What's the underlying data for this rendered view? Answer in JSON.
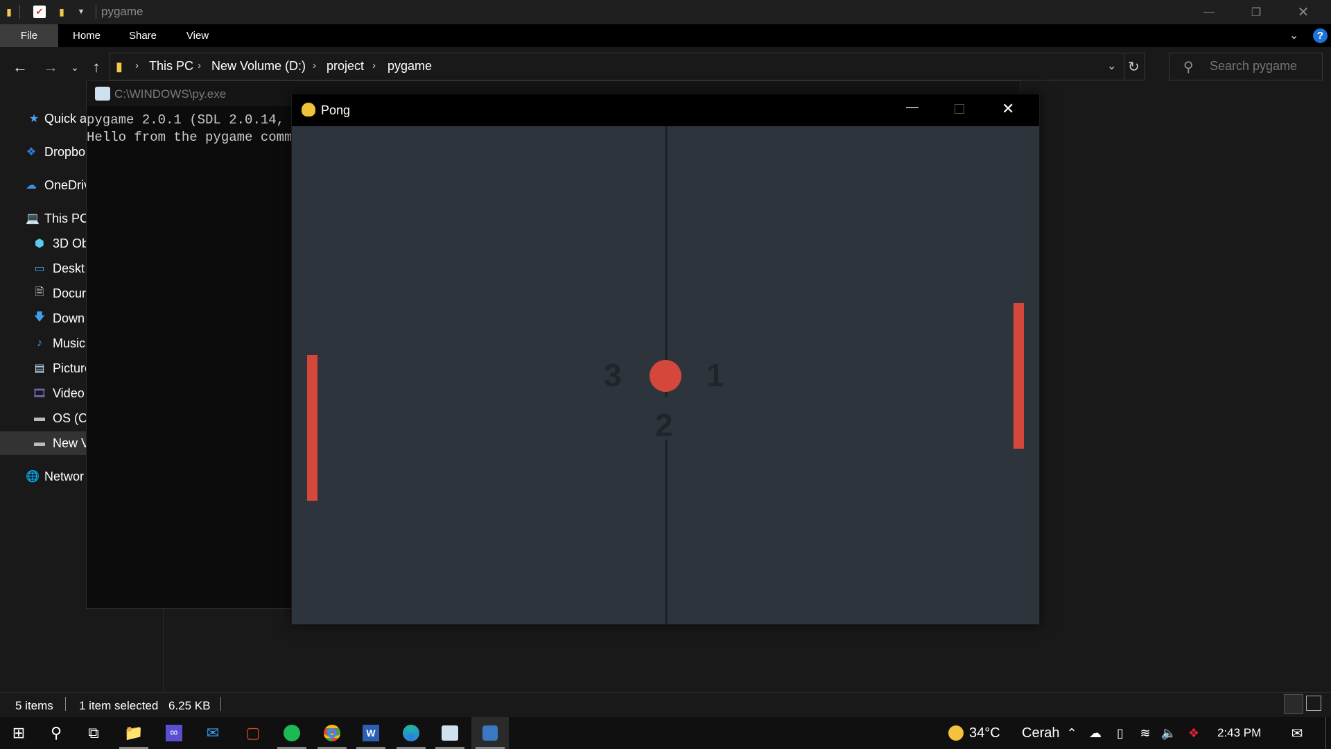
{
  "explorer": {
    "title": "pygame",
    "ribbon_tabs": [
      "File",
      "Home",
      "Share",
      "View"
    ],
    "breadcrumb": [
      "This PC",
      "New Volume (D:)",
      "project",
      "pygame"
    ],
    "search_placeholder": "Search pygame",
    "nav_items": {
      "quick_access": "Quick a",
      "dropbox": "Dropbo",
      "onedrive": "OneDriv",
      "this_pc": "This PC",
      "objects_3d": "3D Ob",
      "desktop": "Deskt",
      "documents": "Docur",
      "downloads": "Down",
      "music": "Music",
      "pictures": "Picture",
      "videos": "Video",
      "os_c": "OS (C:",
      "new_volume": "New V",
      "network": "Networ"
    },
    "status": {
      "items_count": "5 items",
      "selected": "1 item selected",
      "size": "6.25 KB"
    }
  },
  "console": {
    "title": "C:\\WINDOWS\\py.exe",
    "line1": "pygame 2.0.1 (SDL 2.0.14, P",
    "line2": "Hello from the pygame commu"
  },
  "pong": {
    "title": "Pong",
    "score_left": "3",
    "score_right": "1",
    "center_number": "2",
    "colors": {
      "background": "#2d343c",
      "paddle": "#d5473a",
      "ball": "#d5473a",
      "net": "#1d232a"
    }
  },
  "taskbar": {
    "weather_temp": "34°C",
    "weather_desc": "Cerah",
    "clock": "2:43 PM",
    "apps": [
      "start-icon",
      "search-icon",
      "task-view-icon",
      "file-explorer-icon",
      "visual-studio-icon",
      "mail-icon",
      "office-icon",
      "spotify-icon",
      "chrome-icon",
      "word-icon",
      "edge-icon",
      "python-launcher-icon",
      "pygame-icon"
    ]
  }
}
